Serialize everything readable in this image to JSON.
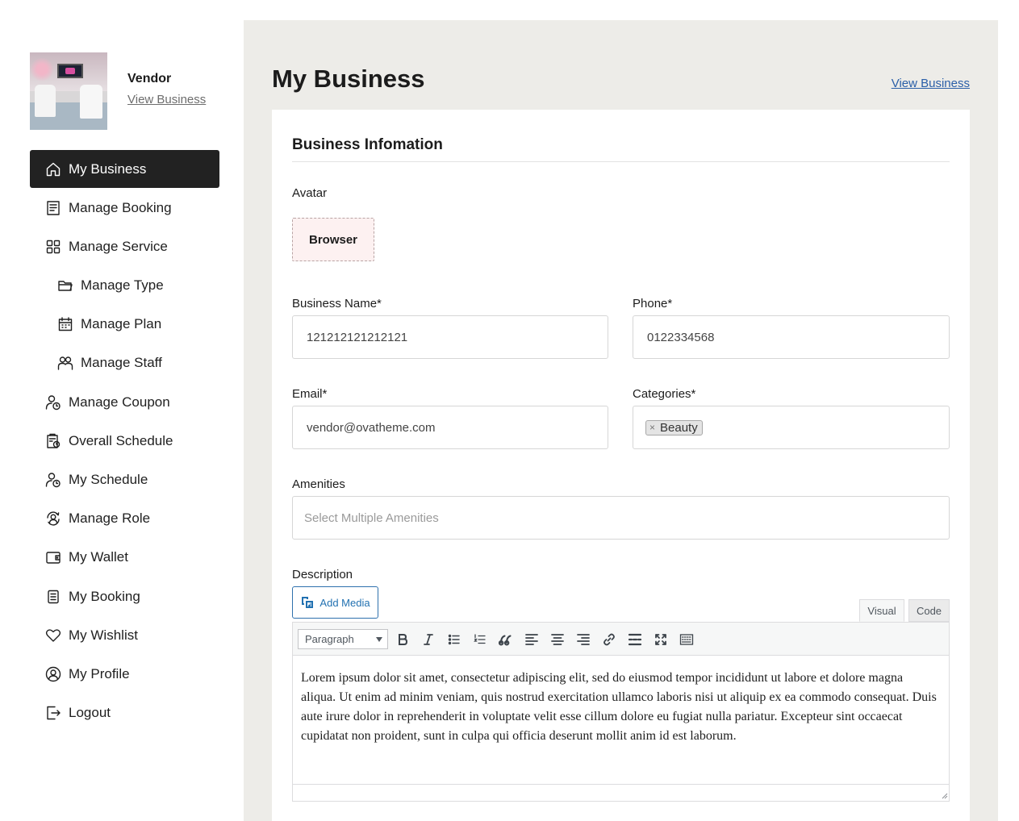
{
  "sidebar": {
    "profile": {
      "name": "Vendor",
      "view_link": "View Business"
    },
    "items": [
      {
        "label": "My Business",
        "icon": "home-icon",
        "active": true
      },
      {
        "label": "Manage Booking",
        "icon": "booking-list-icon"
      },
      {
        "label": "Manage Service",
        "icon": "grid-icon"
      },
      {
        "label": "Manage Type",
        "icon": "folder-icon"
      },
      {
        "label": "Manage Plan",
        "icon": "calendar-icon"
      },
      {
        "label": "Manage Staff",
        "icon": "staff-icon"
      },
      {
        "label": "Manage Coupon",
        "icon": "user-clock-icon"
      },
      {
        "label": "Overall Schedule",
        "icon": "schedule-icon"
      },
      {
        "label": "My Schedule",
        "icon": "user-clock-icon"
      },
      {
        "label": "Manage Role",
        "icon": "role-icon"
      },
      {
        "label": "My Wallet",
        "icon": "wallet-icon"
      },
      {
        "label": "My Booking",
        "icon": "document-icon"
      },
      {
        "label": "My Wishlist",
        "icon": "heart-icon"
      },
      {
        "label": "My Profile",
        "icon": "user-circle-icon"
      },
      {
        "label": "Logout",
        "icon": "logout-icon"
      }
    ]
  },
  "main": {
    "title": "My Business",
    "view_business": "View Business",
    "section_title": "Business Infomation",
    "avatar_label": "Avatar",
    "browser_button": "Browser",
    "business_name": {
      "label": "Business Name*",
      "value": "121212121212121"
    },
    "phone": {
      "label": "Phone*",
      "value": "0122334568"
    },
    "email": {
      "label": "Email*",
      "value": "vendor@ovatheme.com"
    },
    "categories": {
      "label": "Categories*",
      "tags": [
        "Beauty"
      ],
      "remove_glyph": "×"
    },
    "amenities": {
      "label": "Amenities",
      "placeholder": "Select Multiple Amenities"
    },
    "description": {
      "label": "Description",
      "add_media": "Add Media",
      "tabs": {
        "visual": "Visual",
        "code": "Code"
      },
      "format_select": "Paragraph",
      "text": "Lorem ipsum dolor sit amet, consectetur adipiscing elit, sed do eiusmod tempor incididunt ut labore et dolore magna aliqua. Ut enim ad minim veniam, quis nostrud exercitation ullamco laboris nisi ut aliquip ex ea commodo consequat. Duis aute irure dolor in reprehenderit in voluptate velit esse cillum dolore eu fugiat nulla pariatur. Excepteur sint occaecat cupidatat non proident, sunt in culpa qui officia deserunt mollit anim id est laborum."
    },
    "toolbar_icons": [
      "bold-icon",
      "italic-icon",
      "bullet-list-icon",
      "numbered-list-icon",
      "blockquote-icon",
      "align-left-icon",
      "align-center-icon",
      "align-right-icon",
      "link-icon",
      "read-more-icon",
      "fullscreen-icon",
      "keyboard-toolbar-icon"
    ]
  },
  "colors": {
    "active_nav_bg": "#222222",
    "main_bg": "#edece8",
    "link_blue": "#2b5fa8",
    "wp_blue": "#2271b1"
  }
}
